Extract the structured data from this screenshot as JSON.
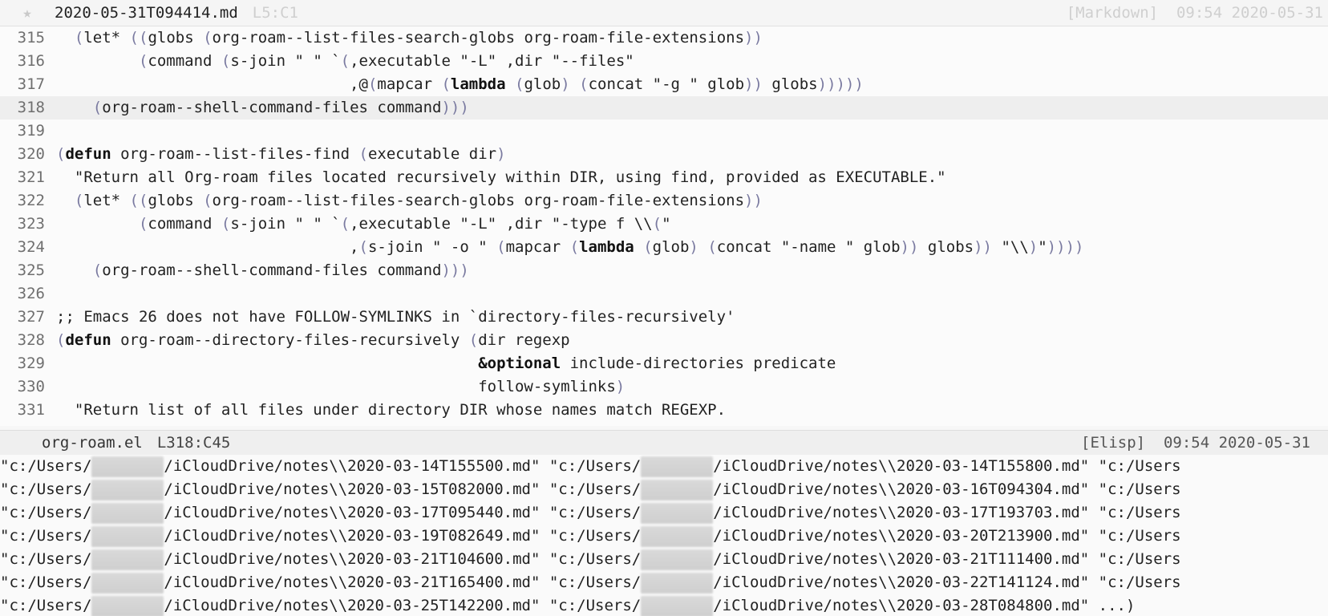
{
  "topbar": {
    "star": "★",
    "filename": "2020-05-31T094414.md",
    "position": "L5:C1",
    "mode": "[Markdown]",
    "time": "09:54 2020-05-31"
  },
  "editor": {
    "lines": [
      {
        "num": "315",
        "text": "  (let* ((globs (org-roam--list-files-search-globs org-roam-file-extensions))"
      },
      {
        "num": "316",
        "text": "         (command (s-join \" \" `(,executable \"-L\" ,dir \"--files\""
      },
      {
        "num": "317",
        "text": "                                ,@(mapcar (lambda (glob) (concat \"-g \" glob)) globs)))))"
      },
      {
        "num": "318",
        "text": "    (org-roam--shell-command-files command)))"
      },
      {
        "num": "319",
        "text": ""
      },
      {
        "num": "320",
        "text": "(defun org-roam--list-files-find (executable dir)"
      },
      {
        "num": "321",
        "text": "  \"Return all Org-roam files located recursively within DIR, using find, provided as EXECUTABLE.\""
      },
      {
        "num": "322",
        "text": "  (let* ((globs (org-roam--list-files-search-globs org-roam-file-extensions))"
      },
      {
        "num": "323",
        "text": "         (command (s-join \" \" `(,executable \"-L\" ,dir \"-type f \\\\(\""
      },
      {
        "num": "324",
        "text": "                                ,(s-join \" -o \" (mapcar (lambda (glob) (concat \"-name \" glob)) globs)) \"\\\\)\"))))"
      },
      {
        "num": "325",
        "text": "    (org-roam--shell-command-files command)))"
      },
      {
        "num": "326",
        "text": ""
      },
      {
        "num": "327",
        "text": ";; Emacs 26 does not have FOLLOW-SYMLINKS in `directory-files-recursively'"
      },
      {
        "num": "328",
        "text": "(defun org-roam--directory-files-recursively (dir regexp"
      },
      {
        "num": "329",
        "text": "                                              &optional include-directories predicate"
      },
      {
        "num": "330",
        "text": "                                              follow-symlinks)"
      },
      {
        "num": "331",
        "text": "  \"Return list of all files under directory DIR whose names match REGEXP."
      }
    ]
  },
  "statusbar": {
    "filename": "org-roam.el",
    "position": "L318:C45",
    "mode": "[Elisp]",
    "time": "09:54 2020-05-31"
  },
  "minibuffer": {
    "rows": [
      {
        "a_pre": "\"c:/Users/",
        "a_post": "/iCloudDrive/notes\\\\2020-03-14T155500.md\"",
        "b_pre": " \"c:/Users/",
        "b_post": "/iCloudDrive/notes\\\\2020-03-14T155800.md\"",
        "c": " \"c:/Users"
      },
      {
        "a_pre": "\"c:/Users/",
        "a_post": "/iCloudDrive/notes\\\\2020-03-15T082000.md\"",
        "b_pre": " \"c:/Users/",
        "b_post": "/iCloudDrive/notes\\\\2020-03-16T094304.md\"",
        "c": " \"c:/Users"
      },
      {
        "a_pre": "\"c:/Users/",
        "a_post": "/iCloudDrive/notes\\\\2020-03-17T095440.md\"",
        "b_pre": " \"c:/Users/",
        "b_post": "/iCloudDrive/notes\\\\2020-03-17T193703.md\"",
        "c": " \"c:/Users"
      },
      {
        "a_pre": "\"c:/Users/",
        "a_post": "/iCloudDrive/notes\\\\2020-03-19T082649.md\"",
        "b_pre": " \"c:/Users/",
        "b_post": "/iCloudDrive/notes\\\\2020-03-20T213900.md\"",
        "c": " \"c:/Users"
      },
      {
        "a_pre": "\"c:/Users/",
        "a_post": "/iCloudDrive/notes\\\\2020-03-21T104600.md\"",
        "b_pre": " \"c:/Users/",
        "b_post": "/iCloudDrive/notes\\\\2020-03-21T111400.md\"",
        "c": " \"c:/Users"
      },
      {
        "a_pre": "\"c:/Users/",
        "a_post": "/iCloudDrive/notes\\\\2020-03-21T165400.md\"",
        "b_pre": " \"c:/Users/",
        "b_post": "/iCloudDrive/notes\\\\2020-03-22T141124.md\"",
        "c": " \"c:/Users"
      },
      {
        "a_pre": "\"c:/Users/",
        "a_post": "/iCloudDrive/notes\\\\2020-03-25T142200.md\"",
        "b_pre": " \"c:/Users/",
        "b_post": "/iCloudDrive/notes\\\\2020-03-28T084800.md\"",
        "c": " ...)"
      }
    ]
  }
}
